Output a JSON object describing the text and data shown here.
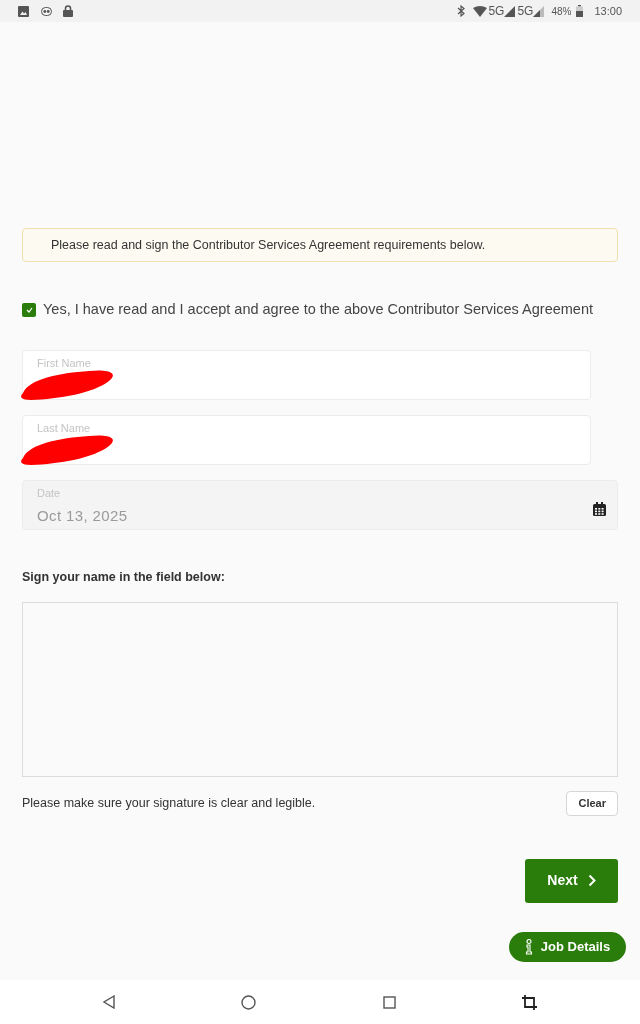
{
  "status_bar": {
    "network_1": "5G",
    "network_2": "5G",
    "battery": "48%",
    "time": "13:00"
  },
  "notice": "Please read and sign the Contributor Services Agreement requirements below.",
  "agreement": {
    "label": "Yes, I have read and I accept and agree to the above Contributor Services Agreement",
    "checked": true
  },
  "fields": [
    {
      "kind": "text",
      "label": "First Name",
      "redacted": true
    },
    {
      "kind": "text",
      "label": "Last Name",
      "redacted": true
    },
    {
      "kind": "date",
      "label": "Date",
      "value": "Oct 13, 2025",
      "disabled": true
    }
  ],
  "signature": {
    "heading": "Sign your name in the field below:",
    "hint": "Please make sure your signature is clear and legible.",
    "clear_button": "Clear"
  },
  "next_button": "Next",
  "job_details_button": "Job Details"
}
